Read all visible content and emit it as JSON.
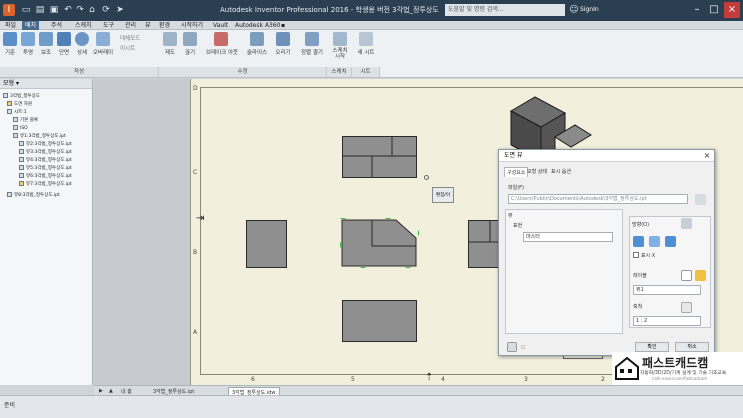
{
  "app": {
    "title": "Autodesk Inventor Professional 2016 - 학생용 버전   3각법_정투상도",
    "search_placeholder": "도움말 및 명령 검색...",
    "user": "SignIn"
  },
  "menu_tabs": [
    "파일",
    "배치",
    "주석",
    "스케치",
    "도구",
    "관리",
    "뷰",
    "환경",
    "시작하기",
    "Vault",
    "Autodesk A360",
    "▪"
  ],
  "active_menu_tab_index": 1,
  "ribbon": {
    "buttons": [
      "기준",
      "투영",
      "보조",
      "단면",
      "상세",
      "오버레이",
      "새도우",
      "기보",
      "제도",
      "끊기",
      "브레이크 아웃",
      "슬라이스",
      "오리기",
      "정렬 결기",
      "스케치 시작",
      "새 시트"
    ],
    "small_buttons": [
      "대체모드",
      "이시트"
    ],
    "groups": [
      "작성",
      "수정",
      "스케치",
      "시트"
    ]
  },
  "browser": {
    "title": "모형 ▾",
    "rows": [
      "3각법_정투상도",
      "도면 자원",
      "시트:1",
      "기본 블록",
      "ISO",
      "뷰1:3각법_정투상도.ipt",
      "뷰2:3각법_정투상도.ipt",
      "뷰3:3각법_정투상도.ipt",
      "뷰4:3각법_정투상도.ipt",
      "뷰5:3각법_정투상도.ipt",
      "뷰6:3각법_정투상도.ipt",
      "뷰7:3각법_정투상도.ipt",
      "뷰8:3각법_정투상도.ipt"
    ]
  },
  "drawing": {
    "row_letters": [
      "D",
      "C",
      "B",
      "A"
    ],
    "col_numbers": [
      "6",
      "5",
      "4",
      "3",
      "2",
      "1"
    ],
    "floating_button": "편집/이",
    "title_block_text": "Autodesk"
  },
  "dialog": {
    "title": "도면 뷰",
    "tabs": [
      "구성요소",
      "모형 상태",
      "표시 옵션",
      "플랫 패턴"
    ],
    "file_label": "파일(F)",
    "file_path": "C:\\Users\\Public\\Documents\\Autodesk\\3각법_정투상도.ipt",
    "view_label": "뷰",
    "rep_label": "표현",
    "rep_value": "마스터",
    "orient_label": "방향(O)",
    "style_label": "스타일(T)",
    "label_label": "레이블",
    "label_value": "뷰1",
    "scale_label": "축척",
    "scale_value": "1 : 2",
    "visible_label": "표시 X",
    "ok": "확인",
    "cancel": "취소"
  },
  "sheet_tabs": [
    "▶",
    "▲",
    "내 홈",
    "3각법_정투상도.ipt",
    "3각법_정투상도.idw"
  ],
  "active_sheet_tab_index": 4,
  "status": "준비",
  "logo": {
    "big": "패스트캐드캠",
    "small": "자동화/3D/2D/기계 설계 및 기술 기초교육",
    "url": "cafe.naver.com/fastcadcam"
  },
  "colors": {
    "titlebar": "#2b3f52",
    "sheet": "#f2f0dc",
    "view_fill": "#8f8f8f",
    "selection": "#3fbf3f"
  }
}
